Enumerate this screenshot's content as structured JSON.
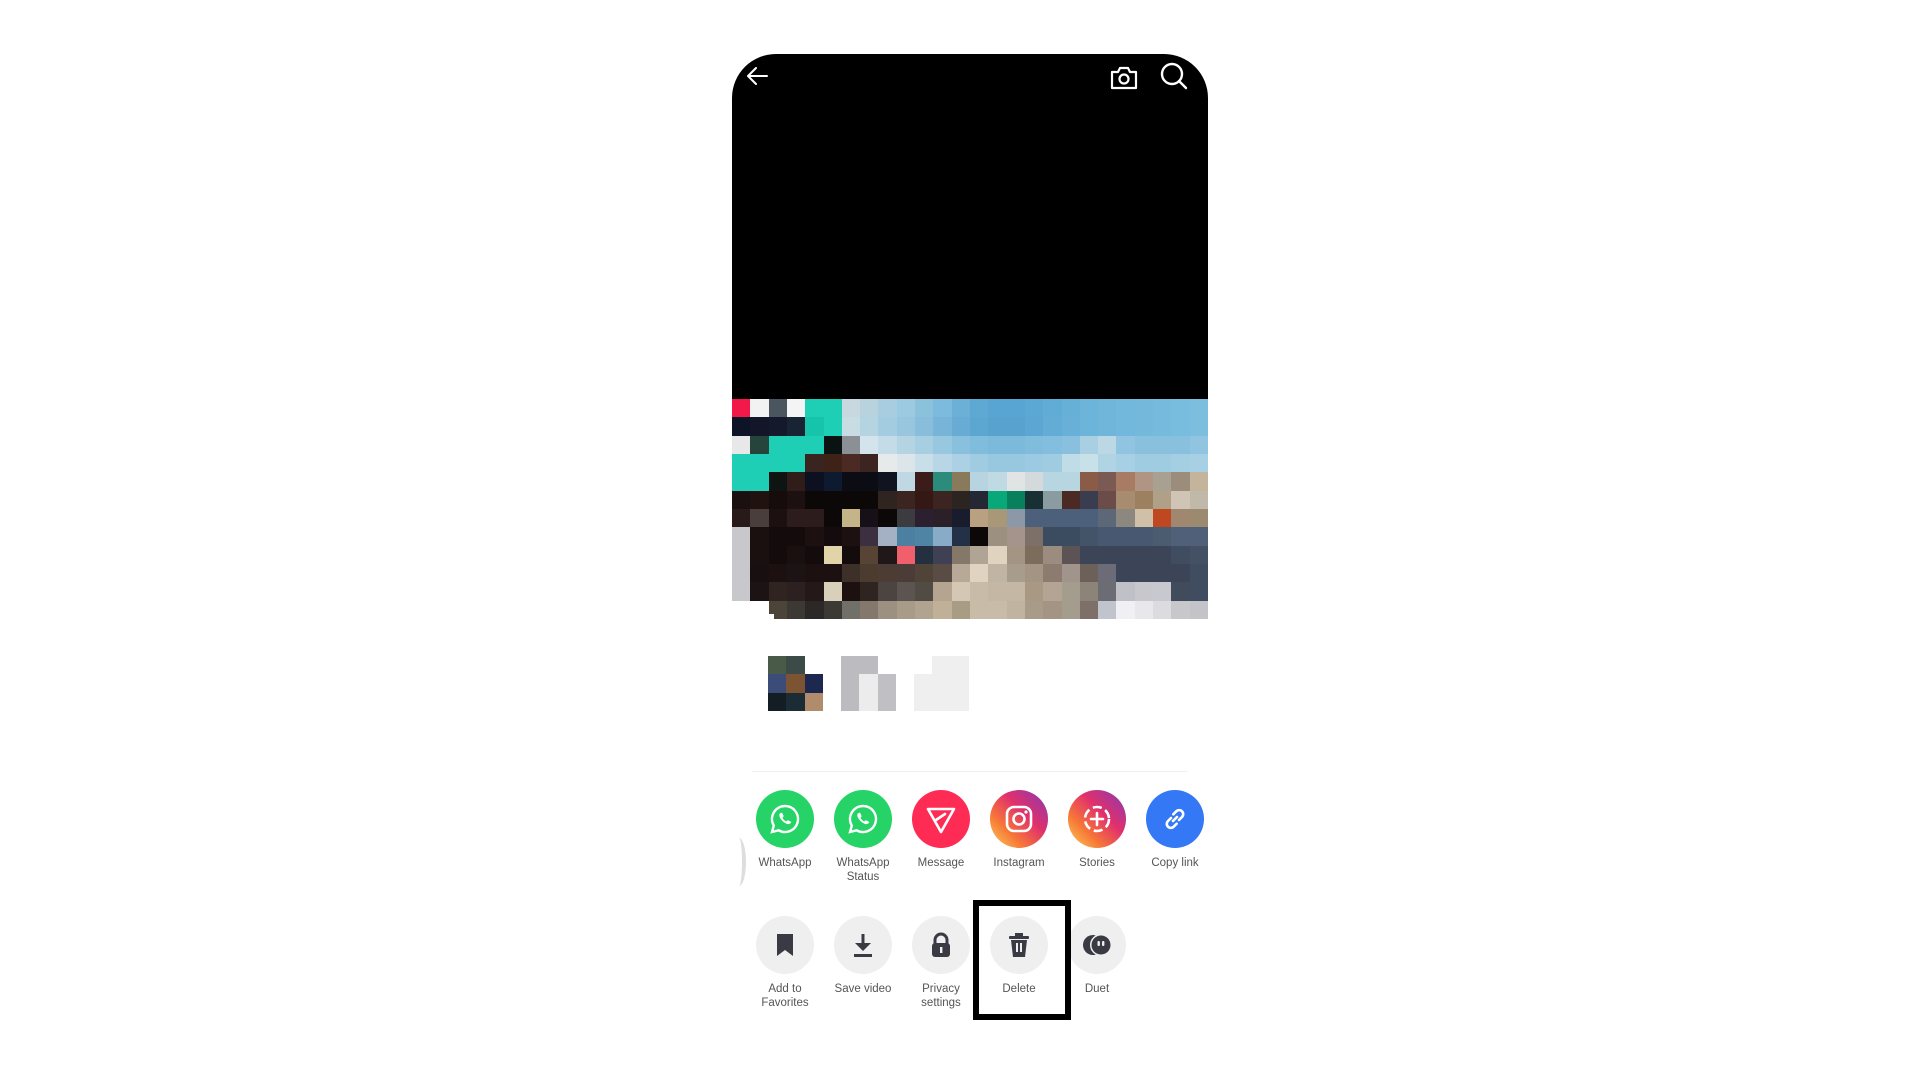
{
  "topbar": {
    "icons": [
      "back-arrow-icon",
      "camera-icon",
      "search-icon"
    ]
  },
  "share_row": [
    {
      "label": "WhatsApp",
      "icon": "whatsapp-icon",
      "color": "#25D366"
    },
    {
      "label": "WhatsApp\nStatus",
      "icon": "whatsapp-status-icon",
      "color": "#25D366"
    },
    {
      "label": "Message",
      "icon": "message-send-icon",
      "color": "#FE2C55"
    },
    {
      "label": "Instagram",
      "icon": "instagram-icon",
      "color": "gradient-instagram"
    },
    {
      "label": "Stories",
      "icon": "stories-icon",
      "color": "gradient-instagram"
    },
    {
      "label": "Copy link",
      "icon": "link-icon",
      "color": "#3478F6"
    }
  ],
  "action_row": [
    {
      "label": "Add to\nFavorites",
      "icon": "bookmark-icon"
    },
    {
      "label": "Save video",
      "icon": "download-icon"
    },
    {
      "label": "Privacy\nsettings",
      "icon": "lock-icon"
    },
    {
      "label": "Delete",
      "icon": "trash-icon",
      "highlighted": true
    },
    {
      "label": "Duet",
      "icon": "duet-icon"
    }
  ],
  "colors": {
    "whatsapp": "#25D366",
    "message": "#FE2C55",
    "copy_link": "#3478F6",
    "action_bg": "#efefef",
    "action_icon": "#3a3a44",
    "highlight_border": "#000000"
  }
}
